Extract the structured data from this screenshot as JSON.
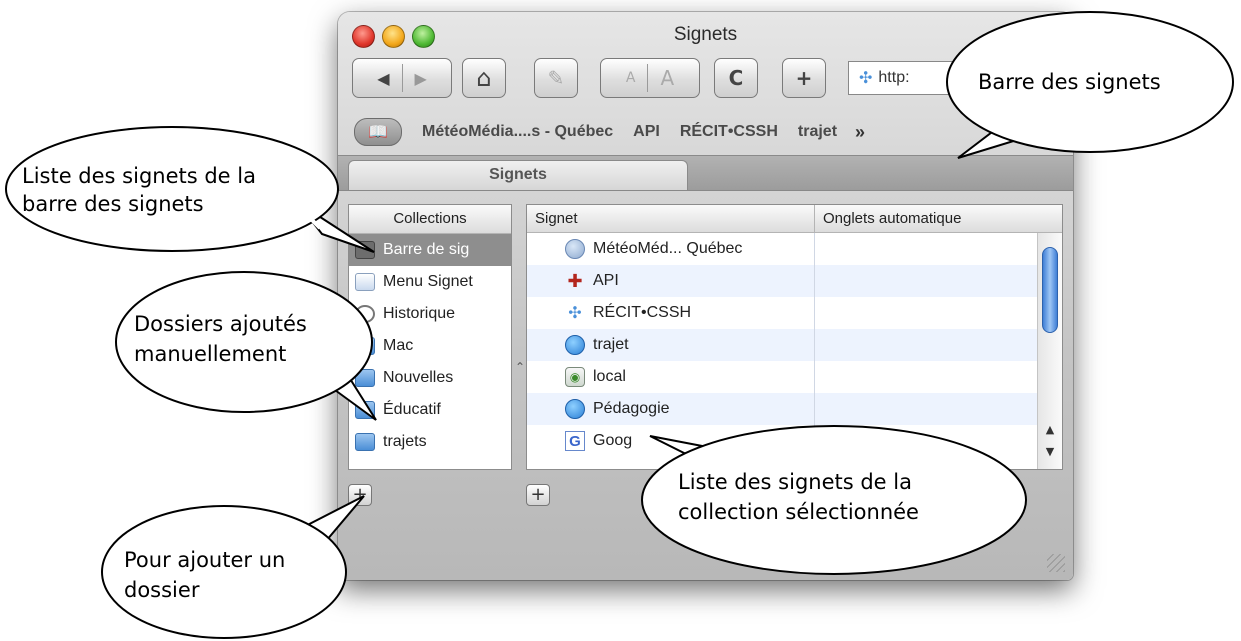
{
  "window": {
    "title": "Signets",
    "url_text": "http:",
    "toolbar": {
      "back_glyph": "◀",
      "forward_glyph": "▶",
      "home_glyph": "⌂",
      "edit_glyph": "✎",
      "text_small": "A",
      "text_large": "A",
      "reload_glyph": "C",
      "add_glyph": "+"
    }
  },
  "bookmarks_bar": {
    "items": [
      "MétéoMédia....s - Québec",
      "API",
      "RÉCIT•CSSH",
      "trajet"
    ],
    "more": "»"
  },
  "tab": {
    "label": "Signets"
  },
  "collections": {
    "header": "Collections",
    "items": [
      {
        "label": "Barre de sig",
        "icon": "bookmarks-bar-icon",
        "selected": true
      },
      {
        "label": "Menu Signet",
        "icon": "bookmarks-menu-icon",
        "selected": false
      },
      {
        "label": "Historique",
        "icon": "history-icon",
        "selected": false
      },
      {
        "label": "Mac",
        "icon": "folder-icon",
        "selected": false
      },
      {
        "label": "Nouvelles",
        "icon": "folder-icon",
        "selected": false
      },
      {
        "label": "Éducatif",
        "icon": "folder-icon",
        "selected": false
      },
      {
        "label": "trajets",
        "icon": "folder-icon",
        "selected": false
      }
    ],
    "add_label": "+"
  },
  "bookmarks_table": {
    "col_signet": "Signet",
    "col_tabs": "Onglets automatique",
    "rows": [
      {
        "name": "MétéoMéd... Québec",
        "icon": "globe-icon"
      },
      {
        "name": "API",
        "icon": "api-icon"
      },
      {
        "name": "RÉCIT•CSSH",
        "icon": "link-icon"
      },
      {
        "name": "trajet",
        "icon": "safari-icon"
      },
      {
        "name": "local",
        "icon": "local-file-icon"
      },
      {
        "name": "Pédagogie",
        "icon": "safari-icon"
      },
      {
        "name": "Goog",
        "icon": "google-icon",
        "icon_glyph": "G"
      }
    ],
    "add_label": "+",
    "scroll_up": "▲",
    "scroll_down": "▼"
  },
  "callouts": {
    "bar": "Barre des signets",
    "list_bar_1": "Liste des signets de la",
    "list_bar_2": "barre des signets",
    "folders_1": "Dossiers ajoutés",
    "folders_2": "manuellement",
    "add_1": "Pour ajouter un",
    "add_2": "dossier",
    "collection_1": "Liste des signets de la",
    "collection_2": "collection sélectionnée"
  }
}
